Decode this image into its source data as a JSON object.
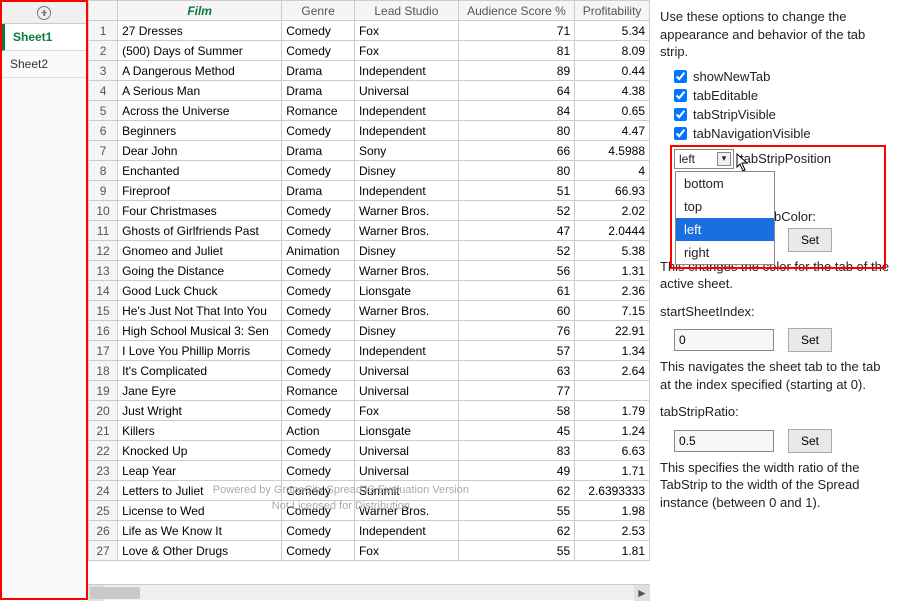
{
  "tabs": {
    "items": [
      {
        "label": "Sheet1",
        "active": true
      },
      {
        "label": "Sheet2",
        "active": false
      }
    ]
  },
  "columns": [
    "Film",
    "Genre",
    "Lead Studio",
    "Audience Score %",
    "Profitability"
  ],
  "rows": [
    {
      "n": 1,
      "film": "27 Dresses",
      "genre": "Comedy",
      "studio": "Fox",
      "aud": "71",
      "prof": "5.34"
    },
    {
      "n": 2,
      "film": "(500) Days of Summer",
      "genre": "Comedy",
      "studio": "Fox",
      "aud": "81",
      "prof": "8.09"
    },
    {
      "n": 3,
      "film": "A Dangerous Method",
      "genre": "Drama",
      "studio": "Independent",
      "aud": "89",
      "prof": "0.44"
    },
    {
      "n": 4,
      "film": "A Serious Man",
      "genre": "Drama",
      "studio": "Universal",
      "aud": "64",
      "prof": "4.38"
    },
    {
      "n": 5,
      "film": "Across the Universe",
      "genre": "Romance",
      "studio": "Independent",
      "aud": "84",
      "prof": "0.65"
    },
    {
      "n": 6,
      "film": "Beginners",
      "genre": "Comedy",
      "studio": "Independent",
      "aud": "80",
      "prof": "4.47"
    },
    {
      "n": 7,
      "film": "Dear John",
      "genre": "Drama",
      "studio": "Sony",
      "aud": "66",
      "prof": "4.5988"
    },
    {
      "n": 8,
      "film": "Enchanted",
      "genre": "Comedy",
      "studio": "Disney",
      "aud": "80",
      "prof": "4"
    },
    {
      "n": 9,
      "film": "Fireproof",
      "genre": "Drama",
      "studio": "Independent",
      "aud": "51",
      "prof": "66.93"
    },
    {
      "n": 10,
      "film": "Four Christmases",
      "genre": "Comedy",
      "studio": "Warner Bros.",
      "aud": "52",
      "prof": "2.02"
    },
    {
      "n": 11,
      "film": "Ghosts of Girlfriends Past",
      "genre": "Comedy",
      "studio": "Warner Bros.",
      "aud": "47",
      "prof": "2.0444"
    },
    {
      "n": 12,
      "film": "Gnomeo and Juliet",
      "genre": "Animation",
      "studio": "Disney",
      "aud": "52",
      "prof": "5.38"
    },
    {
      "n": 13,
      "film": "Going the Distance",
      "genre": "Comedy",
      "studio": "Warner Bros.",
      "aud": "56",
      "prof": "1.31"
    },
    {
      "n": 14,
      "film": "Good Luck Chuck",
      "genre": "Comedy",
      "studio": "Lionsgate",
      "aud": "61",
      "prof": "2.36"
    },
    {
      "n": 15,
      "film": "He's Just Not That Into You",
      "genre": "Comedy",
      "studio": "Warner Bros.",
      "aud": "60",
      "prof": "7.15"
    },
    {
      "n": 16,
      "film": "High School Musical 3: Sen",
      "genre": "Comedy",
      "studio": "Disney",
      "aud": "76",
      "prof": "22.91"
    },
    {
      "n": 17,
      "film": "I Love You Phillip Morris",
      "genre": "Comedy",
      "studio": "Independent",
      "aud": "57",
      "prof": "1.34"
    },
    {
      "n": 18,
      "film": "It's Complicated",
      "genre": "Comedy",
      "studio": "Universal",
      "aud": "63",
      "prof": "2.64"
    },
    {
      "n": 19,
      "film": "Jane Eyre",
      "genre": "Romance",
      "studio": "Universal",
      "aud": "77",
      "prof": ""
    },
    {
      "n": 20,
      "film": "Just Wright",
      "genre": "Comedy",
      "studio": "Fox",
      "aud": "58",
      "prof": "1.79"
    },
    {
      "n": 21,
      "film": "Killers",
      "genre": "Action",
      "studio": "Lionsgate",
      "aud": "45",
      "prof": "1.24"
    },
    {
      "n": 22,
      "film": "Knocked Up",
      "genre": "Comedy",
      "studio": "Universal",
      "aud": "83",
      "prof": "6.63"
    },
    {
      "n": 23,
      "film": "Leap Year",
      "genre": "Comedy",
      "studio": "Universal",
      "aud": "49",
      "prof": "1.71"
    },
    {
      "n": 24,
      "film": "Letters to Juliet",
      "genre": "Comedy",
      "studio": "Summit",
      "aud": "62",
      "prof": "2.6393333"
    },
    {
      "n": 25,
      "film": "License to Wed",
      "genre": "Comedy",
      "studio": "Warner Bros.",
      "aud": "55",
      "prof": "1.98"
    },
    {
      "n": 26,
      "film": "Life as We Know It",
      "genre": "Comedy",
      "studio": "Independent",
      "aud": "62",
      "prof": "2.53"
    },
    {
      "n": 27,
      "film": "Love & Other Drugs",
      "genre": "Comedy",
      "studio": "Fox",
      "aud": "55",
      "prof": "1.81"
    }
  ],
  "watermark": {
    "l1": "Powered by GrapeCity SpreadJS Evaluation Version",
    "l2": "Not Licensed for Distribution"
  },
  "panel": {
    "intro": "Use these options to change the appearance and behavior of the tab strip.",
    "checks": [
      {
        "label": "showNewTab",
        "checked": true
      },
      {
        "label": "tabEditable",
        "checked": true
      },
      {
        "label": "tabStripVisible",
        "checked": true
      },
      {
        "label": "tabNavigationVisible",
        "checked": true
      }
    ],
    "position": {
      "label": "tabStripPosition",
      "value": "left",
      "options": [
        "bottom",
        "top",
        "left",
        "right"
      ]
    },
    "colorLabel": "bColor:",
    "setLabel": "Set",
    "colorDesc": "This changes the color for the tab of the active sheet.",
    "startLabel": "startSheetIndex:",
    "startValue": "0",
    "startDesc": "This navigates the sheet tab to the tab at the index specified (starting at 0).",
    "ratioLabel": "tabStripRatio:",
    "ratioValue": "0.5",
    "ratioDesc": "This specifies the width ratio of the TabStrip to the width of the Spread instance (between 0 and 1)."
  }
}
